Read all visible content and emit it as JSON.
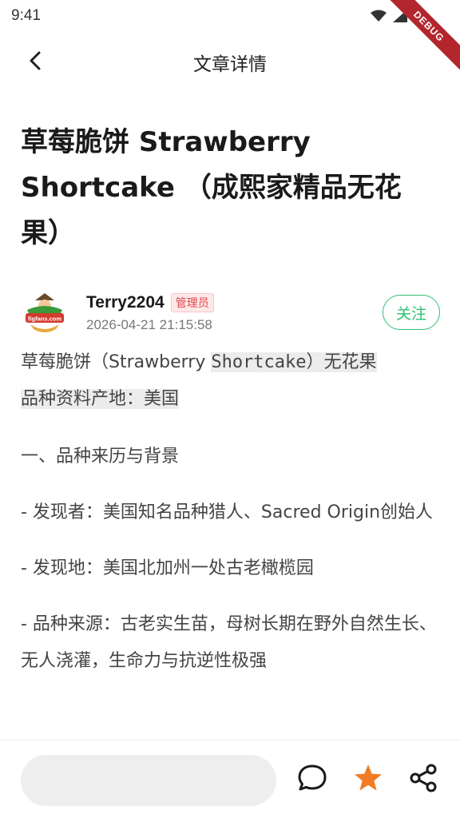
{
  "status_bar": {
    "time": "9:41",
    "debug_label": "DEBUG",
    "icons": [
      "wifi-icon",
      "cellular-icon",
      "battery-icon"
    ]
  },
  "app_bar": {
    "title": "文章详情",
    "back_icon": "chevron-left-icon"
  },
  "article": {
    "title": "草莓脆饼 Strawberry Shortcake （成熙家精品无花果）",
    "author": {
      "name": "Terry2204",
      "badge": "管理员",
      "time": "2026-04-21 21:15:58",
      "avatar_text": "figfans.com"
    },
    "follow_label": "关注",
    "intro": {
      "part1": "草莓脆饼（Strawberry ",
      "part2": "Shortcake",
      "part3": "）无花果",
      "line2": "品种资料产地：美国"
    },
    "paragraphs": [
      "一、品种来历与背景",
      "- 发现者：美国知名品种猎人、Sacred Origin创始人",
      "- 发现地：美国北加州一处古老橄榄园",
      "- 品种来源：古老实生苗，母树长期在野外自然生长、无人浇灌，生命力与抗逆性极强"
    ]
  },
  "bottom_bar": {
    "comment_placeholder": "",
    "icons": [
      "comment-icon",
      "star-icon",
      "share-icon"
    ],
    "star_color": "#f07c24"
  },
  "colors": {
    "accent_green": "#2fbf71",
    "badge_red": "#e0494f",
    "debug_red": "#b3262d"
  }
}
